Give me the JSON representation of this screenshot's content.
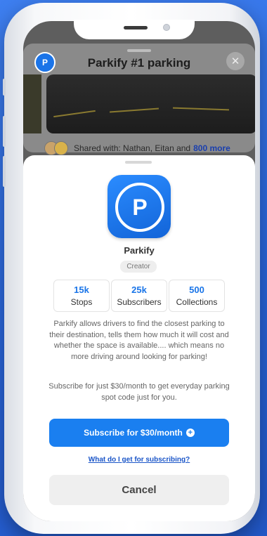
{
  "background_card": {
    "title": "Parkify #1 parking",
    "logo_letter": "P",
    "close_symbol": "✕",
    "shared_text": "Shared with: Nathan, Eitan and",
    "shared_more": "800 more"
  },
  "profile": {
    "icon_letter": "P",
    "name": "Parkify",
    "badge": "Creator"
  },
  "stats": [
    {
      "value": "15k",
      "label": "Stops"
    },
    {
      "value": "25k",
      "label": "Subscribers"
    },
    {
      "value": "500",
      "label": "Collections"
    }
  ],
  "description": "Parkify allows drivers to find the closest parking to their destination, tells them how much it will cost and whether the space is available.... which means no more driving around looking for parking!",
  "subscribe_note": "Subscribe for just $30/month to get everyday parking spot code just for you.",
  "actions": {
    "subscribe_label": "Subscribe for $30/month",
    "subscribe_icon": "+",
    "info_link": "What do I get for subscribing?",
    "cancel_label": "Cancel"
  },
  "colors": {
    "accent": "#1a7ff0",
    "background": "#2f6ee6",
    "link": "#1a55c8"
  }
}
